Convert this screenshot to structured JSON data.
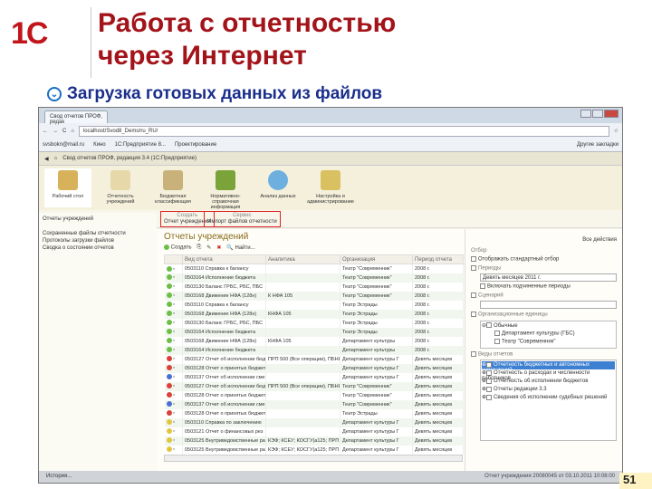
{
  "slide": {
    "logo": "1С",
    "title_line1": "Работа с отчетностью",
    "title_line2": "через Интернет",
    "subtitle": "Загрузка готовых данных из файлов",
    "page_number": "51"
  },
  "browser": {
    "tab": "Свод отчетов ПРОФ, редак",
    "url": "localhost/Svod8_Demo/ru_RU/",
    "bookmarks": [
      "svsbokn@mail.ru",
      "Кино",
      "1С:Предприятие 8...",
      "Проектирование"
    ],
    "other_bookmarks": "Другие закладки"
  },
  "app": {
    "title": "Свод отчетов ПРОФ, редакция 3.4 (1С:Предприятие)",
    "sections": [
      "Рабочий стол",
      "Отчетность учреждений",
      "Бюджетная классификация",
      "Нормативно-справочная информация",
      "Анализ данных",
      "Настройка и администрирование"
    ],
    "groups": [
      {
        "header": "Создать",
        "item": "Отчет учреждения"
      },
      {
        "header": "Сервис",
        "item": "Импорт файлов отчетности"
      }
    ],
    "left_header": "Отчеты учреждений",
    "left_items": [
      "Сохраненные файлы отчетности",
      "Протоколы загрузки файлов",
      "Сводка о состоянии отчетов"
    ],
    "main_title": "Отчеты учреждений",
    "create": "Создать",
    "find": "Найти...",
    "all_actions": "Все действия",
    "columns": [
      "Вид отчета",
      "Аналитика",
      "Организация",
      "Период отчета"
    ],
    "rows": [
      {
        "s": "#6cbf45",
        "kind": "0503110 Справка к балансу",
        "an": "",
        "org": "Театр \"Современник\"",
        "per": "2008 г."
      },
      {
        "s": "#6cbf45",
        "kind": "0503164 Исполнение бюджета",
        "an": "",
        "org": "Театр \"Современник\"",
        "per": "2008 г."
      },
      {
        "s": "#6cbf45",
        "kind": "0503130 Баланс ГРБС, РБС, ПБС",
        "an": "",
        "org": "Театр \"Современник\"",
        "per": "2008 г."
      },
      {
        "s": "#6cbf45",
        "kind": "0503168 Движение НФА (128н)",
        "an": "К НФА 105",
        "org": "Театр \"Современник\"",
        "per": "2008 г."
      },
      {
        "s": "#6cbf45",
        "kind": "0503110 Справка к балансу",
        "an": "",
        "org": "Театр Эстрады",
        "per": "2008 г."
      },
      {
        "s": "#6cbf45",
        "kind": "0503168 Движение НФА (128н)",
        "an": "КНФА 105",
        "org": "Театр Эстрады",
        "per": "2008 г."
      },
      {
        "s": "#6cbf45",
        "kind": "0503130 Баланс ГРБС, РБС, ПБС",
        "an": "",
        "org": "Театр Эстрады",
        "per": "2008 г."
      },
      {
        "s": "#6cbf45",
        "kind": "0503164 Исполнение бюджета",
        "an": "",
        "org": "Театр Эстрады",
        "per": "2008 г."
      },
      {
        "s": "#6cbf45",
        "kind": "0503168 Движение НФА (128н)",
        "an": "КНФА 105",
        "org": "Департамент культуры",
        "per": "2008 г."
      },
      {
        "s": "#6cbf45",
        "kind": "0503164 Исполнение бюджета",
        "an": "",
        "org": "Департамент культуры",
        "per": "2008 г."
      },
      {
        "s": "#d9413a",
        "kind": "0503127 Отчет об исполнении бюд",
        "an": "ПРП 500 (Все операции), ПБНКТ",
        "org": "Департамент культуры Г",
        "per": "Девять месяцев"
      },
      {
        "s": "#d9413a",
        "kind": "0503128 Отчет о принятых бюджет",
        "an": "",
        "org": "Департамент культуры Г",
        "per": "Девять месяцев"
      },
      {
        "s": "#4a6fd1",
        "kind": "0503137 Отчет об исполнении сме",
        "an": "",
        "org": "Департамент культуры Г",
        "per": "Девять месяцев"
      },
      {
        "s": "#d9413a",
        "kind": "0503127 Отчет об исполнении бюд",
        "an": "ПРП 500 (Все операции), ПБНКТ",
        "org": "Театр \"Современник\"",
        "per": "Девять месяцев"
      },
      {
        "s": "#d9413a",
        "kind": "0503128 Отчет о принятых бюджет",
        "an": "",
        "org": "Театр \"Современник\"",
        "per": "Девять месяцев"
      },
      {
        "s": "#4a6fd1",
        "kind": "0503137 Отчет об исполнении сме",
        "an": "",
        "org": "Театр \"Современник\"",
        "per": "Девять месяцев"
      },
      {
        "s": "#d9413a",
        "kind": "0503128 Отчет о принятых бюджет",
        "an": "",
        "org": "Театр Эстрады",
        "per": "Девять месяцев"
      },
      {
        "s": "#e0c640",
        "kind": "0503110 Справка по заключению",
        "an": "",
        "org": "Департамент культуры Г",
        "per": "Девять месяцев"
      },
      {
        "s": "#e0c640",
        "kind": "0503121 Отчет о финансовых рез",
        "an": "",
        "org": "Департамент культуры Г",
        "per": "Девять месяцев"
      },
      {
        "s": "#e0c640",
        "kind": "0503125 Внутриведомственные расче",
        "an": "КЭФ; КСЕУ; КОСГУ(а125; ПРП",
        "org": "Департамент культуры Г",
        "per": "Девять месяцев"
      },
      {
        "s": "#e0c640",
        "kind": "0503125 Внутриведомственные ра",
        "an": "КЭФ; КСЕУ; КОСГУ(а125; ПРП",
        "org": "Департамент культуры Г",
        "per": "Девять месяцев"
      }
    ],
    "filter": {
      "header": "Отбор",
      "std": "Отображать стандартный отбор",
      "periods": "Периоды",
      "period_value": "Девять месяцев 2011 г.",
      "include_sub": "Включать подчиненные периоды",
      "scenario": "Сценарий",
      "org_units": "Организационные единицы",
      "orgs": [
        "Обычные",
        "Департамент культуры (ГБС)",
        "Театр \"Современник\""
      ],
      "report_kinds": "Виды отчетов",
      "kinds": [
        "Отчетность бюджетных и автономных учреждений",
        "Отчетность о расходах и численности работников",
        "Отчетность об исполнении бюджетов",
        "Отчеты редакции 3.3",
        "Сведения об исполнении судебных решений"
      ]
    },
    "history": "История...",
    "status": "Отчет учреждения 20080045 от 03.10.2011 10:08:00"
  }
}
